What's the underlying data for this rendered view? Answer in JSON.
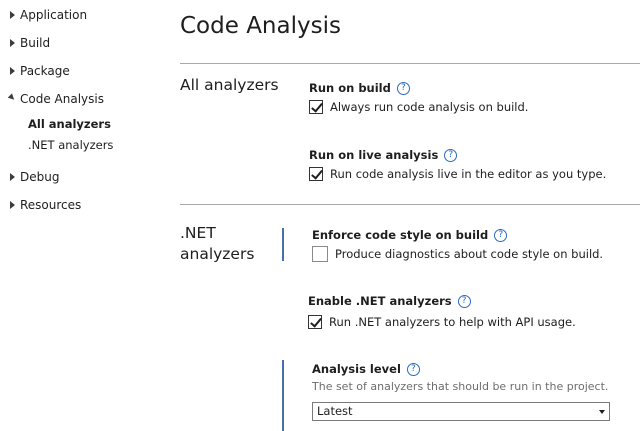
{
  "sidebar": {
    "items": [
      {
        "label": "Application",
        "expanded": false
      },
      {
        "label": "Build",
        "expanded": false
      },
      {
        "label": "Package",
        "expanded": false
      },
      {
        "label": "Code Analysis",
        "expanded": true,
        "children": [
          {
            "label": "All analyzers",
            "selected": true
          },
          {
            "label": ".NET analyzers",
            "selected": false
          }
        ]
      },
      {
        "label": "Debug",
        "expanded": false
      },
      {
        "label": "Resources",
        "expanded": false
      }
    ]
  },
  "main": {
    "title": "Code Analysis",
    "sections": [
      {
        "title": "All analyzers",
        "settings": [
          {
            "title": "Run on build",
            "checkbox_label": "Always run code analysis on build.",
            "checked": true
          },
          {
            "title": "Run on live analysis",
            "checkbox_label": "Run code analysis live in the editor as you type.",
            "checked": true
          }
        ]
      },
      {
        "title": ".NET analyzers",
        "settings": [
          {
            "title": "Enforce code style on build",
            "checkbox_label": "Produce diagnostics about code style on build.",
            "checked": false
          },
          {
            "title": "Enable .NET analyzers",
            "checkbox_label": "Run .NET analyzers to help with API usage.",
            "checked": true
          },
          {
            "title": "Analysis level",
            "description": "The set of analyzers that should be run in the project.",
            "selected_value": "Latest"
          }
        ]
      }
    ]
  },
  "help_glyph": "?",
  "colors": {
    "accent_bar": "#4a6ea9",
    "help_icon": "#2a6ac4"
  }
}
